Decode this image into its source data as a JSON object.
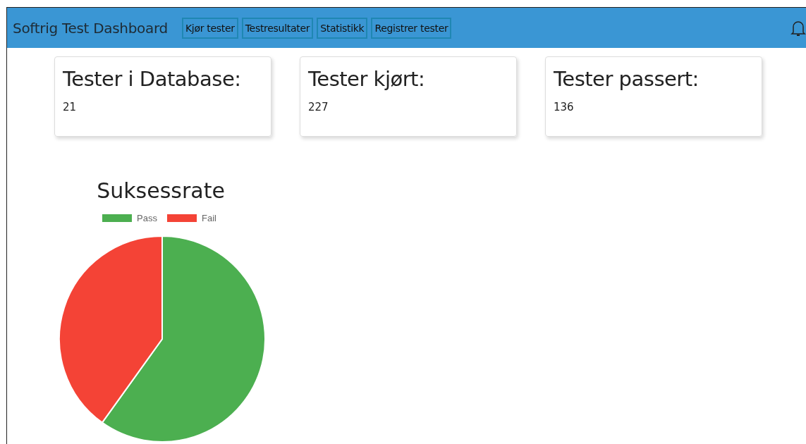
{
  "navbar": {
    "brand": "Softrig Test Dashboard",
    "links": [
      {
        "label": "Kjør tester"
      },
      {
        "label": "Testresultater"
      },
      {
        "label": "Statistikk"
      },
      {
        "label": "Registrer tester"
      }
    ]
  },
  "cards": [
    {
      "title": "Tester i Database:",
      "value": "21"
    },
    {
      "title": "Tester kjørt:",
      "value": "227"
    },
    {
      "title": "Tester passert:",
      "value": "136"
    }
  ],
  "chart": {
    "chart_data": {
      "type": "pie",
      "title": "Suksessrate",
      "categories": [
        "Pass",
        "Fail"
      ],
      "values": [
        59.9,
        40.1
      ],
      "legend": true,
      "colors": [
        "#4caf50",
        "#f44336"
      ]
    }
  }
}
